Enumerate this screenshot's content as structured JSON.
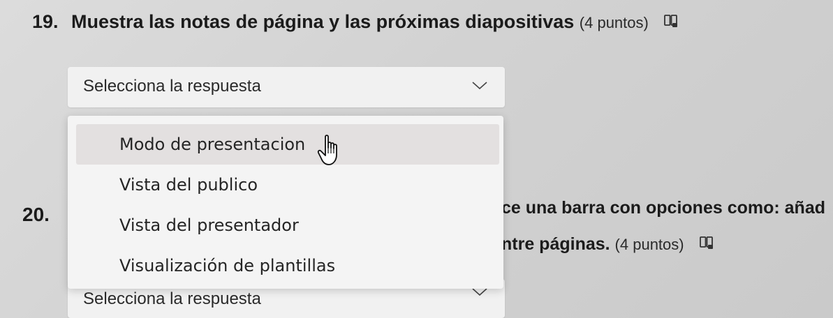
{
  "q19": {
    "number": "19.",
    "title": "Muestra las notas de página y las próximas diapositivas",
    "points": "(4 puntos)",
    "reader_icon": "immersive-reader-icon",
    "select_placeholder": "Selecciona la respuesta",
    "dropdown_open": true,
    "options": [
      "Modo de presentacion",
      "Vista del publico",
      "Vista del presentador",
      "Visualización de plantillas"
    ],
    "hovered_option": "Modo de presentacion"
  },
  "q20": {
    "number": "20.",
    "title_visible_line1": "ce una barra con opciones como: añad",
    "title_visible_line2": "ntre páginas.",
    "points": "(4 puntos)",
    "reader_icon": "immersive-reader-icon",
    "select_placeholder": "Selecciona la respuesta"
  },
  "colors": {
    "page_background": "#d4d4d4",
    "select_background": "#f1f1f1",
    "dropdown_background": "#f4f4f4",
    "hover_background": "#e3e0e0",
    "text": "#1c1c1c"
  }
}
